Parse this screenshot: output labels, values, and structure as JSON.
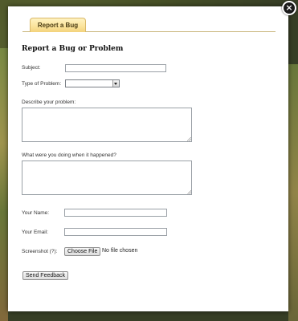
{
  "tab": {
    "label": "Report a Bug"
  },
  "form": {
    "heading": "Report a Bug or Problem",
    "subject": {
      "label": "Subject:",
      "value": ""
    },
    "problem_type": {
      "label": "Type of Problem:",
      "selected": ""
    },
    "description": {
      "label": "Describe your problem:",
      "value": ""
    },
    "activity": {
      "label": "What were you doing when it happened?",
      "value": ""
    },
    "name": {
      "label": "Your Name:",
      "value": ""
    },
    "email": {
      "label": "Your Email:",
      "value": ""
    },
    "screenshot": {
      "label": "Screenshot (?):",
      "button_label": "Choose File",
      "status": "No file chosen"
    },
    "submit_label": "Send Feedback"
  },
  "close": {
    "glyph": "×"
  },
  "colors": {
    "tab_bg": "#fbe39a",
    "tab_border": "#d9b869",
    "panel_bg": "#ffffff"
  }
}
